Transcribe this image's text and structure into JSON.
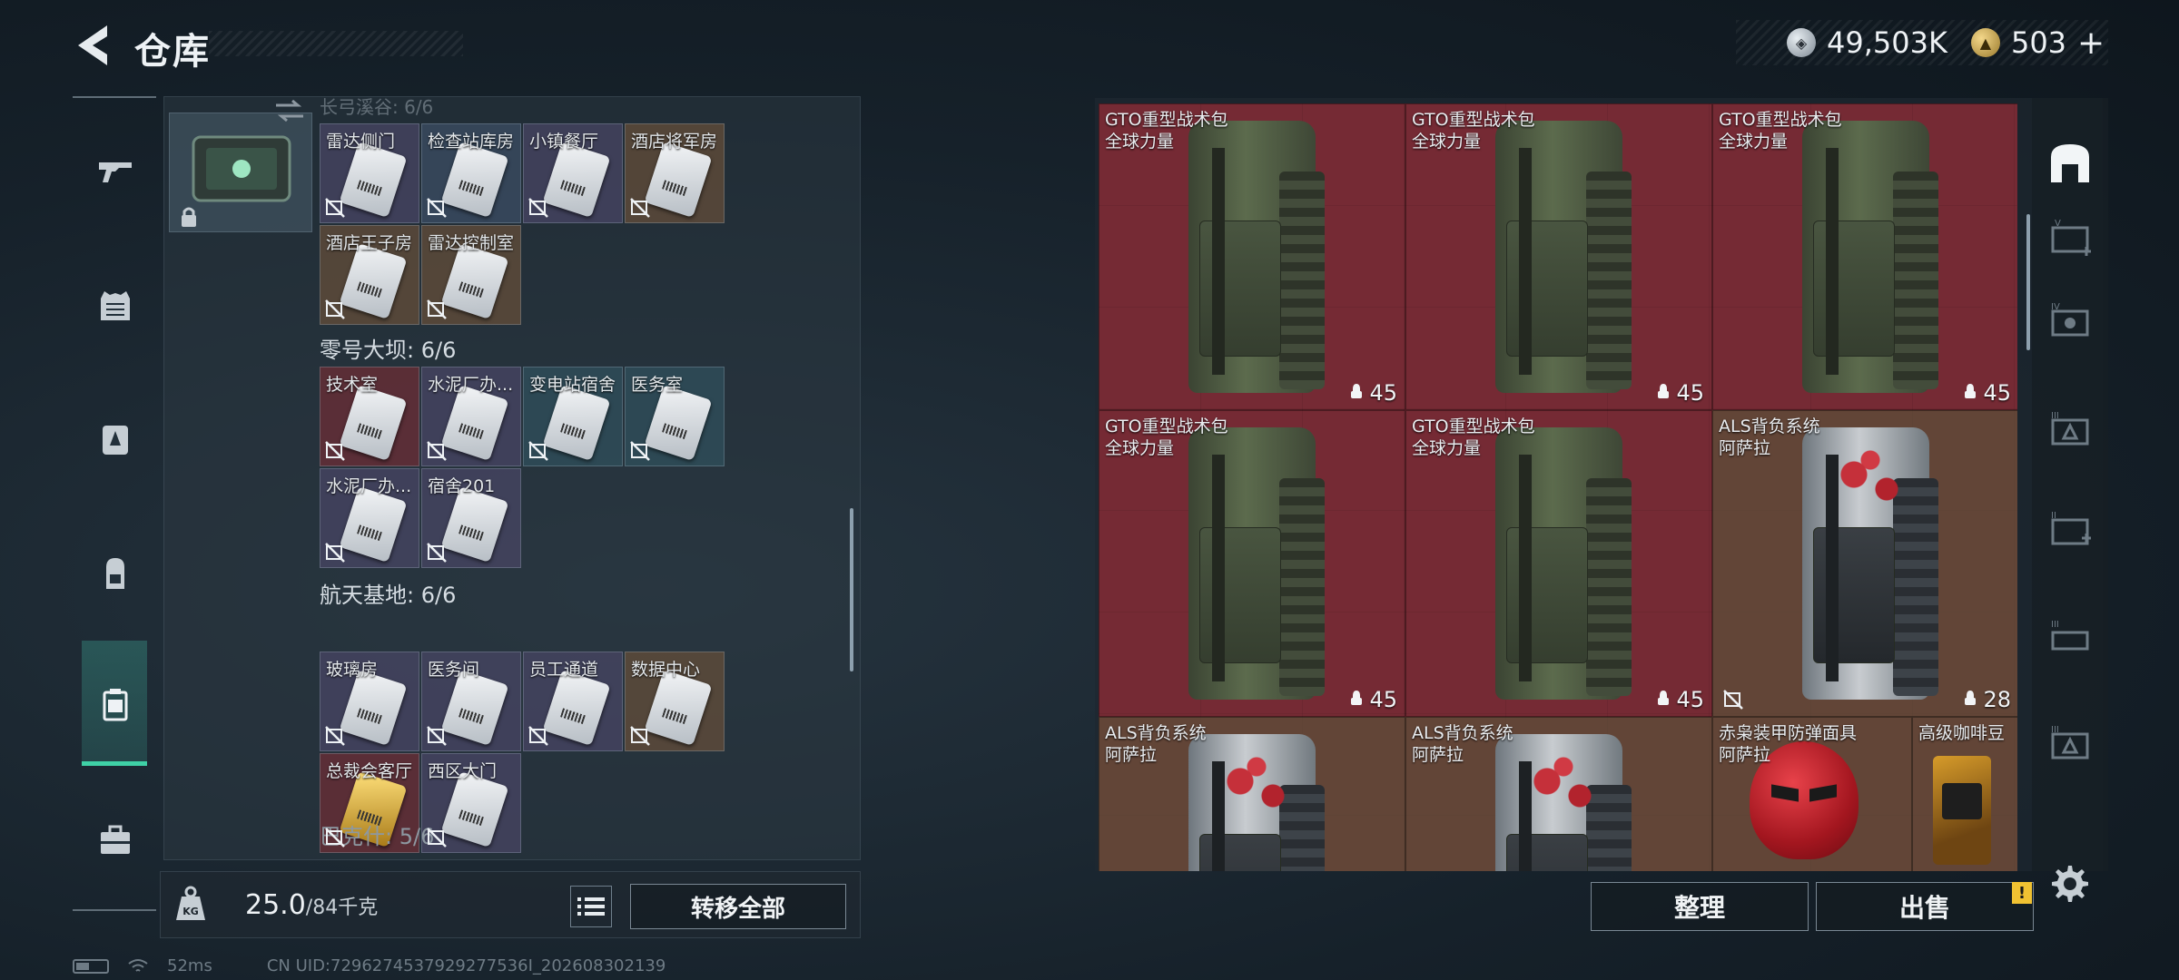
{
  "header": {
    "title": "仓库"
  },
  "currency": [
    {
      "icon": "silver-coin-icon",
      "value": "49,503K"
    },
    {
      "icon": "gold-coin-icon",
      "value": "503"
    }
  ],
  "currency_plus": "+",
  "left_rail": [
    "gun-icon",
    "armor-vest-icon",
    "backpack-medic-icon",
    "backpack-icon",
    "storage-box-icon",
    "briefcase-icon"
  ],
  "stash_list": {
    "partial_header": "长弓溪谷: 6/6",
    "groups": [
      {
        "header": "",
        "cards": [
          {
            "label": "雷达侧门",
            "color": "purple"
          },
          {
            "label": "检查站库房",
            "color": "blue"
          },
          {
            "label": "小镇餐厅",
            "color": "purple"
          },
          {
            "label": "酒店将军房",
            "color": "brown"
          },
          {
            "label": "酒店王子房",
            "color": "brown"
          },
          {
            "label": "雷达控制室",
            "color": "brown"
          }
        ]
      },
      {
        "header": "零号大坝: 6/6",
        "cards": [
          {
            "label": "技术室",
            "color": "red"
          },
          {
            "label": "水泥厂办...",
            "color": "purple"
          },
          {
            "label": "变电站宿舍",
            "color": "teal"
          },
          {
            "label": "医务室",
            "color": "teal"
          },
          {
            "label": "水泥厂办...",
            "color": "purple"
          },
          {
            "label": "宿舍201",
            "color": "purple"
          }
        ]
      },
      {
        "header": "航天基地: 6/6",
        "cards": [
          {
            "label": "玻璃房",
            "color": "purple"
          },
          {
            "label": "医务间",
            "color": "purple"
          },
          {
            "label": "员工通道",
            "color": "purple"
          },
          {
            "label": "数据中心",
            "color": "brown"
          },
          {
            "label": "总裁会客厅",
            "color": "red",
            "gold": true
          },
          {
            "label": "西区大门",
            "color": "purple"
          }
        ]
      }
    ],
    "next_header": "巴克什: 5/6"
  },
  "weight": {
    "current": "25.0",
    "max_unit": "/84千克"
  },
  "transfer_all": "转移全部",
  "status_bar": {
    "ping": "52ms",
    "uid": "CN UID:7296274537929277536I_202608302139"
  },
  "stash_grid": [
    {
      "name": "GTO重型战术包",
      "sub": "全球力量",
      "capacity": "45",
      "kind": "gto",
      "bg": "red"
    },
    {
      "name": "GTO重型战术包",
      "sub": "全球力量",
      "capacity": "45",
      "kind": "gto",
      "bg": "red"
    },
    {
      "name": "GTO重型战术包",
      "sub": "全球力量",
      "capacity": "45",
      "kind": "gto",
      "bg": "red"
    },
    {
      "name": "GTO重型战术包",
      "sub": "全球力量",
      "capacity": "45",
      "kind": "gto",
      "bg": "red"
    },
    {
      "name": "GTO重型战术包",
      "sub": "全球力量",
      "capacity": "45",
      "kind": "gto",
      "bg": "red"
    },
    {
      "name": "ALS背负系统",
      "sub": "阿萨拉",
      "capacity": "28",
      "kind": "als",
      "bg": "brown",
      "nosign": true
    },
    {
      "name": "ALS背负系统",
      "sub": "阿萨拉",
      "capacity": "",
      "kind": "als",
      "bg": "brown"
    },
    {
      "name": "ALS背负系统",
      "sub": "阿萨拉",
      "capacity": "",
      "kind": "als",
      "bg": "brown"
    },
    {
      "name": "赤枭装甲防弹面具",
      "sub": "阿萨拉",
      "capacity": "",
      "kind": "mask",
      "bg": "brown"
    },
    {
      "name": "高级咖啡豆",
      "sub": "",
      "capacity": "",
      "kind": "coffee",
      "bg": "brown"
    }
  ],
  "category_rail": [
    "stash-home-icon",
    "tier-v-stash-icon",
    "tier-iv-stash-icon",
    "tier-iii-stash-icon",
    "tier-ii-stash-icon",
    "tier-iii-stash-icon-2",
    "tier-iii-stash-icon-3"
  ],
  "actions": {
    "sort": "整理",
    "sell": "出售",
    "alert": "!"
  },
  "colors": {
    "accent": "#3fd1a6",
    "red_rarity": "#6e2a33",
    "gold_rarity": "#a87a18"
  }
}
